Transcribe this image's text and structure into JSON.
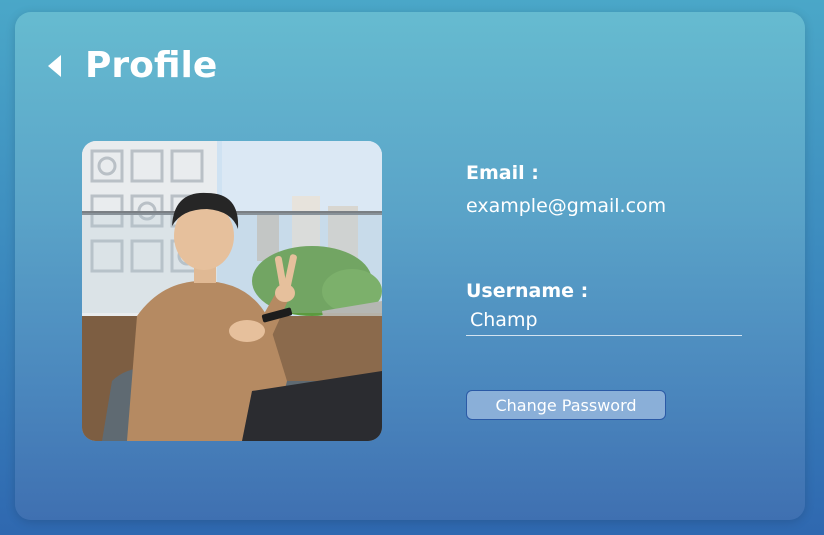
{
  "header": {
    "title": "Profile",
    "back_icon": "caret-left-icon"
  },
  "profile": {
    "photo": "profile-photo",
    "email_label": "Email :",
    "email_value": "example@gmail.com",
    "username_label": "Username :",
    "username_value": "Champ",
    "change_password_label": "Change Password"
  },
  "colors": {
    "accent_border": "#2b5aa6",
    "text": "#ffffff"
  }
}
